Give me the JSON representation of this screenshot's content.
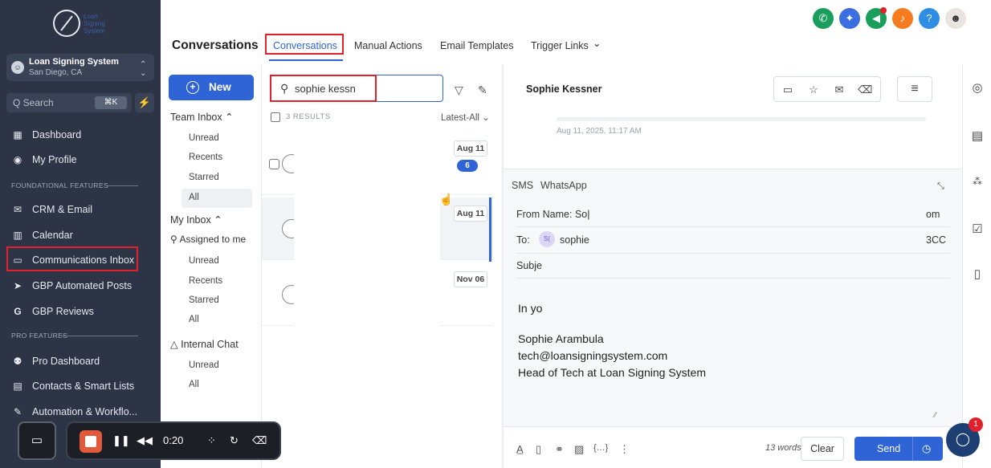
{
  "sidebar": {
    "logo_text": [
      "Loan",
      "Signing",
      "System"
    ],
    "location": {
      "name": "Loan Signing System",
      "city": "San Diego, CA",
      "avatar": "☺"
    },
    "search": {
      "label": "Q Search",
      "shortcut": "⌘K"
    },
    "sections": {
      "foundational": "FOUNDATIONAL FEATURES",
      "pro": "PRO FEATURES"
    },
    "items": [
      {
        "label": "Dashboard",
        "icon": "dashboard-icon"
      },
      {
        "label": "My Profile",
        "icon": "profile-icon"
      },
      {
        "label": "CRM & Email",
        "icon": "mail-icon"
      },
      {
        "label": "Calendar",
        "icon": "calendar-icon"
      },
      {
        "label": "Communications Inbox",
        "icon": "inbox-icon"
      },
      {
        "label": "GBP Automated Posts",
        "icon": "send-icon"
      },
      {
        "label": "GBP Reviews",
        "icon": "google-icon"
      },
      {
        "label": "Pro Dashboard",
        "icon": "group-icon"
      },
      {
        "label": "Contacts & Smart Lists",
        "icon": "contacts-icon"
      },
      {
        "label": "Automation & Workflo...",
        "icon": "pencil-icon"
      }
    ]
  },
  "header": {
    "title": "Conversations",
    "tabs": [
      {
        "label": "Conversations",
        "active": true
      },
      {
        "label": "Manual Actions"
      },
      {
        "label": "Email Templates"
      },
      {
        "label": "Trigger Links"
      }
    ],
    "trigger_chevron": "⌄",
    "circle_colors": [
      "#1a9e5c",
      "#3b6fe0",
      "#1a9e5c",
      "#f57c1f",
      "#2f8de4"
    ]
  },
  "inbox_nav": {
    "new_label": "New",
    "team_inbox": "Team Inbox",
    "team_items": [
      "Unread",
      "Recents",
      "Starred",
      "All"
    ],
    "my_inbox": "My Inbox",
    "assigned": "Assigned to me",
    "my_items": [
      "Unread",
      "Recents",
      "Starred",
      "All"
    ],
    "internal_chat": "Internal Chat",
    "chat_items": [
      "Unread",
      "All"
    ]
  },
  "list": {
    "search_value": "sophie kessn",
    "results_label": "3 RESULTS",
    "sort_label": "Latest-All",
    "rows": [
      {
        "date": "Aug 11",
        "badge": "6"
      },
      {
        "date": "Aug 11"
      },
      {
        "date": "Nov 06"
      }
    ]
  },
  "conversation": {
    "contact_name": "Sophie Kessner",
    "message_time": "Aug 11, 2025, 11:17 AM",
    "channels": [
      "SMS",
      "WhatsApp"
    ],
    "from_label": "From Name:",
    "from_value": "So|",
    "from_right": "om",
    "to_label": "To:",
    "to_chip": "S(",
    "to_value": "sophie",
    "to_right": "3CC",
    "subject_label": "Subje",
    "body_start": "In yo",
    "signature": [
      "Sophie Arambula",
      "tech@loansigningsystem.com",
      "Head of Tech at Loan Signing System"
    ],
    "word_count": "13 words",
    "clear_label": "Clear",
    "send_label": "Send"
  },
  "recorder": {
    "time": "0:20"
  },
  "chat_widget": {
    "badge": "1"
  }
}
